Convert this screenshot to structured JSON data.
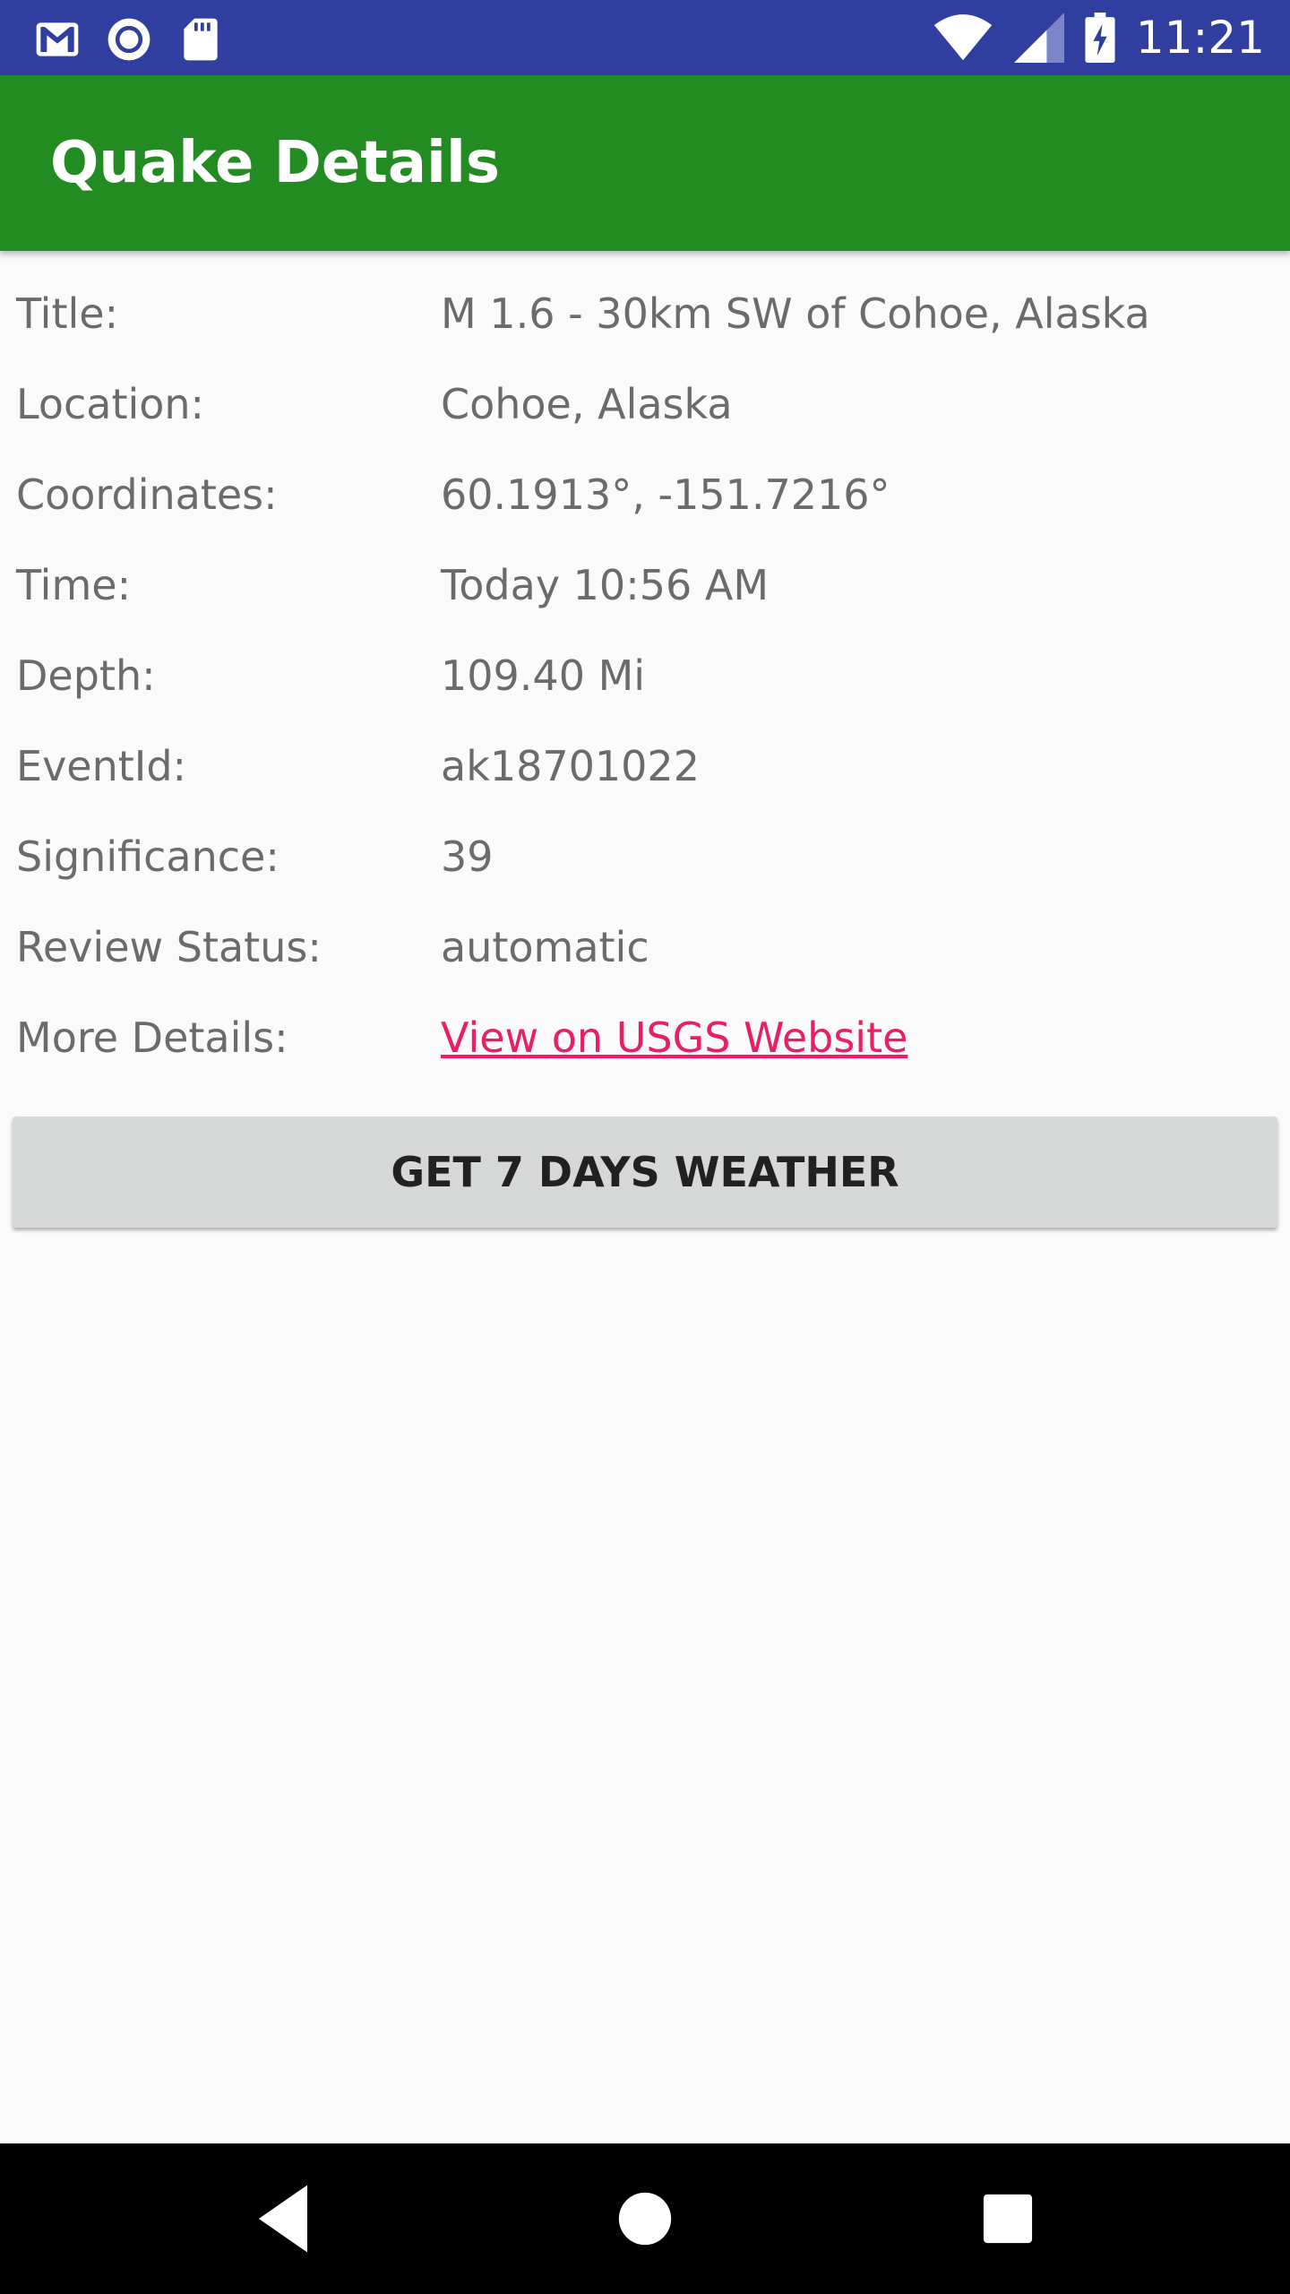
{
  "status_bar": {
    "time": "11:21",
    "left_icons": [
      "gmail-icon",
      "radio-icon",
      "sd-card-icon"
    ],
    "right_icons": [
      "wifi-icon",
      "cell-signal-icon",
      "battery-charging-icon"
    ]
  },
  "app_bar": {
    "title": "Quake Details"
  },
  "details": [
    {
      "label": "Title:",
      "value": "M 1.6 - 30km SW of Cohoe, Alaska"
    },
    {
      "label": "Location:",
      "value": "Cohoe, Alaska"
    },
    {
      "label": "Coordinates:",
      "value": "60.1913°, -151.7216°"
    },
    {
      "label": "Time:",
      "value": "Today 10:56 AM"
    },
    {
      "label": "Depth:",
      "value": "109.40 Mi"
    },
    {
      "label": "EventId:",
      "value": "ak18701022"
    },
    {
      "label": "Significance:",
      "value": "39"
    },
    {
      "label": "Review Status:",
      "value": "automatic"
    },
    {
      "label": "More Details:",
      "value": "View on USGS Website"
    }
  ],
  "weather_button": {
    "label": "GET 7 DAYS WEATHER"
  },
  "colors": {
    "status_bar": "#303f9f",
    "app_bar": "#228b22",
    "link": "#e91e63",
    "button": "#d6d7d7"
  },
  "nav_bar": {
    "buttons": [
      "back-icon",
      "home-icon",
      "recents-icon"
    ]
  }
}
